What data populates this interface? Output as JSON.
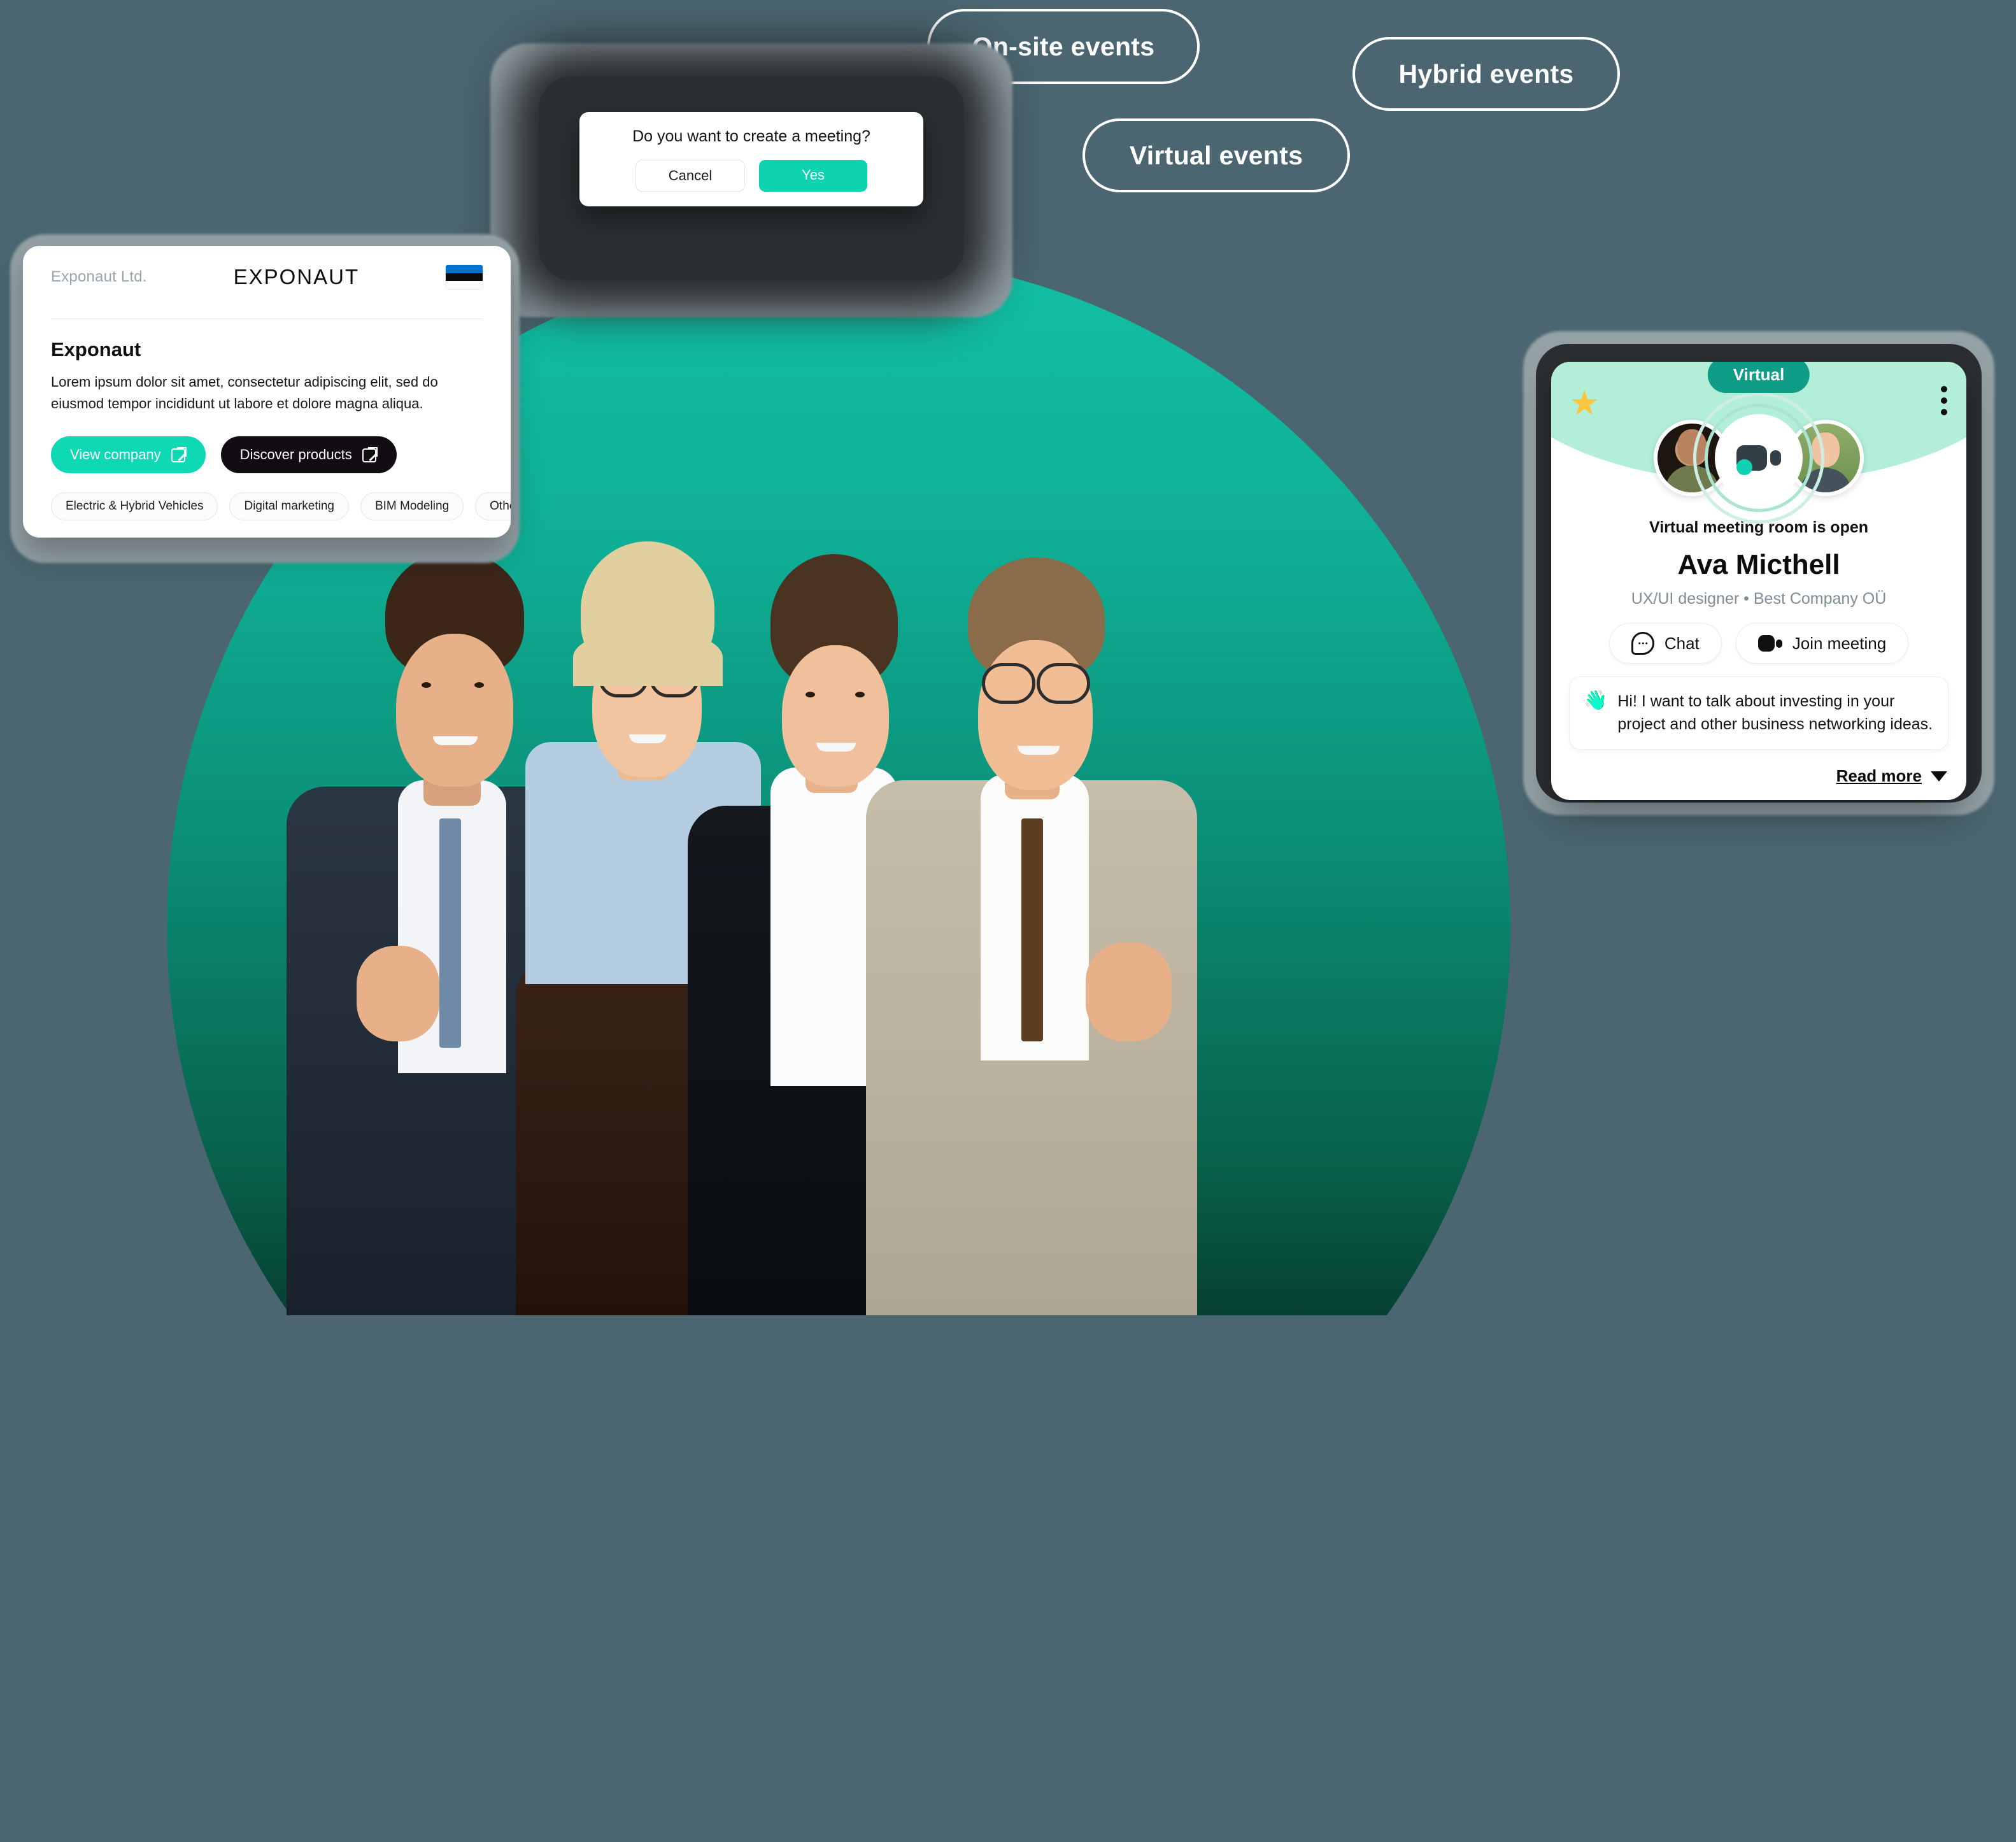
{
  "background_color": "#4b6670",
  "accent_color": "#0fd3b0",
  "event_pills": [
    {
      "label": "On-site events"
    },
    {
      "label": "Hybrid events"
    },
    {
      "label": "Virtual events"
    }
  ],
  "meeting_dialog": {
    "title": "Do you want to create a meeting?",
    "cancel_label": "Cancel",
    "confirm_label": "Yes"
  },
  "exponaut_card": {
    "company_legal_name": "Exponaut Ltd.",
    "logo_text": "EXPONAUT",
    "country_flag": "estonia-flag",
    "title": "Exponaut",
    "description": "Lorem ipsum dolor sit amet, consectetur adipiscing elit, sed do eiusmod tempor incididunt ut labore et dolore magna aliqua.",
    "primary_button": "View company",
    "secondary_button": "Discover products",
    "tags": [
      "Electric & Hybrid Vehicles",
      "Digital marketing",
      "BIM Modeling",
      "Other"
    ]
  },
  "virtual_card": {
    "badge": "Virtual",
    "favorite_icon": "star-icon",
    "menu_icon": "more-vertical-icon",
    "status": "Virtual meeting room is open",
    "name": "Ava Micthell",
    "role": "UX/UI designer • Best Company OÜ",
    "chat_button": "Chat",
    "join_button": "Join meeting",
    "message_icon": "waving-hand-icon",
    "message": "Hi! I want to talk about investing in your project and other business networking ideas.",
    "read_more": "Read more"
  }
}
